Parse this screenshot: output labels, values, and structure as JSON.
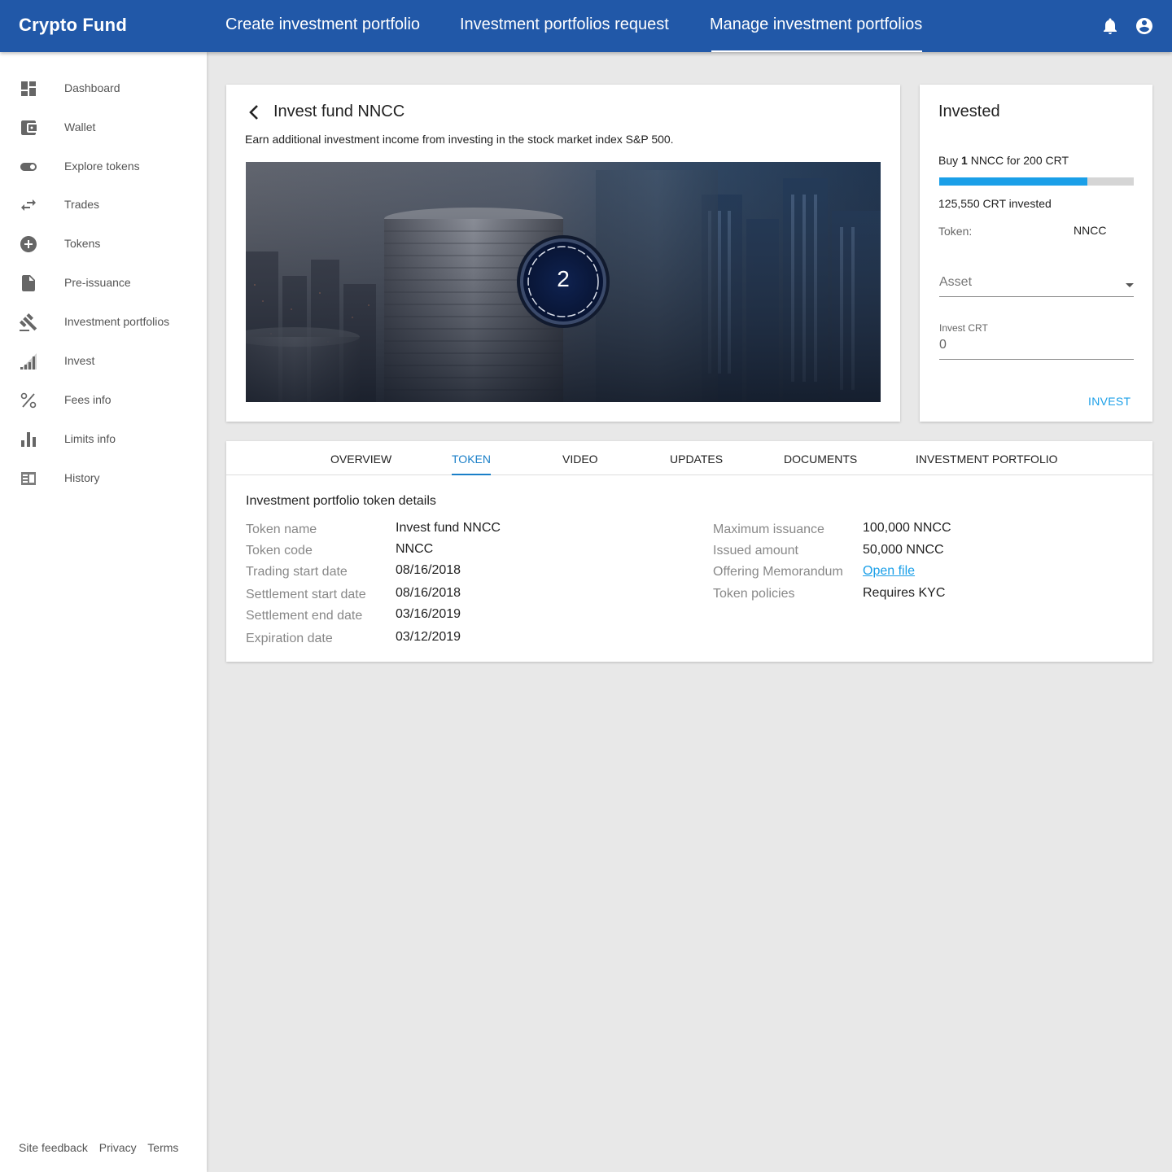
{
  "app": {
    "brand": "Crypto Fund",
    "nav_tabs": [
      "Create investment portfolio",
      "Investment portfolios request",
      "Manage investment portfolios"
    ],
    "active_nav_tab": "Manage investment portfolios",
    "icons": [
      "bell-icon",
      "account-circle-icon"
    ]
  },
  "sidebar": {
    "items": [
      {
        "label": "Dashboard",
        "icon": "dashboard-icon"
      },
      {
        "label": "Wallet",
        "icon": "wallet-icon"
      },
      {
        "label": "Explore tokens",
        "icon": "toggle-icon"
      },
      {
        "label": "Trades",
        "icon": "swap-icon"
      },
      {
        "label": "Tokens",
        "icon": "add-circle-icon"
      },
      {
        "label": "Pre-issuance",
        "icon": "document-icon"
      },
      {
        "label": "Investment portfolios",
        "icon": "gavel-icon"
      },
      {
        "label": "Invest",
        "icon": "signal-bars-icon"
      },
      {
        "label": "Fees info",
        "icon": "percent-icon"
      },
      {
        "label": "Limits info",
        "icon": "bar-chart-icon"
      },
      {
        "label": "History",
        "icon": "history-icon"
      }
    ],
    "footer": [
      "Site feedback",
      "Privacy",
      "Terms"
    ]
  },
  "fund": {
    "title": "Invest fund NNCC",
    "description": "Earn additional investment income from investing in the stock market index S&P 500.",
    "badge": "2"
  },
  "invest_panel": {
    "title": "Invested",
    "buy_prefix": "Buy ",
    "buy_qty": "1",
    "buy_suffix": " NNCC for 200 CRT",
    "progress_fraction": 0.76,
    "invested_text": "125,550 CRT invested",
    "token_label": "Token:",
    "token_value": "NNCC",
    "asset_placeholder": "Asset",
    "invest_label": "Invest CRT",
    "invest_value": "0",
    "invest_button": "INVEST"
  },
  "tabs": {
    "items": [
      "OVERVIEW",
      "TOKEN",
      "VIDEO",
      "UPDATES",
      "DOCUMENTS",
      "INVESTMENT PORTFOLIO"
    ],
    "active": "TOKEN"
  },
  "token_details": {
    "title": "Investment portfolio token details",
    "left": [
      {
        "label": "Token name",
        "value": "Invest fund NNCC"
      },
      {
        "label": "Token code",
        "value": "NNCC"
      },
      {
        "label": "Trading start date",
        "value": "08/16/2018"
      },
      {
        "label": "Settlement start date",
        "value": "08/16/2018"
      },
      {
        "label": "Settlement end date",
        "value": "03/16/2019"
      },
      {
        "label": "Expiration date",
        "value": "03/12/2019"
      }
    ],
    "right": [
      {
        "label": "Maximum issuance",
        "value": "100,000 NNCC"
      },
      {
        "label": "Issued amount",
        "value": "50,000 NNCC"
      },
      {
        "label": "Offering Memorandum",
        "value": "Open file"
      },
      {
        "label": "Token policies",
        "value": "Requires KYC"
      }
    ]
  },
  "colors": {
    "topbar": "#2158a8",
    "accent": "#1a9fe8",
    "tab_active": "#1a7fc8"
  }
}
